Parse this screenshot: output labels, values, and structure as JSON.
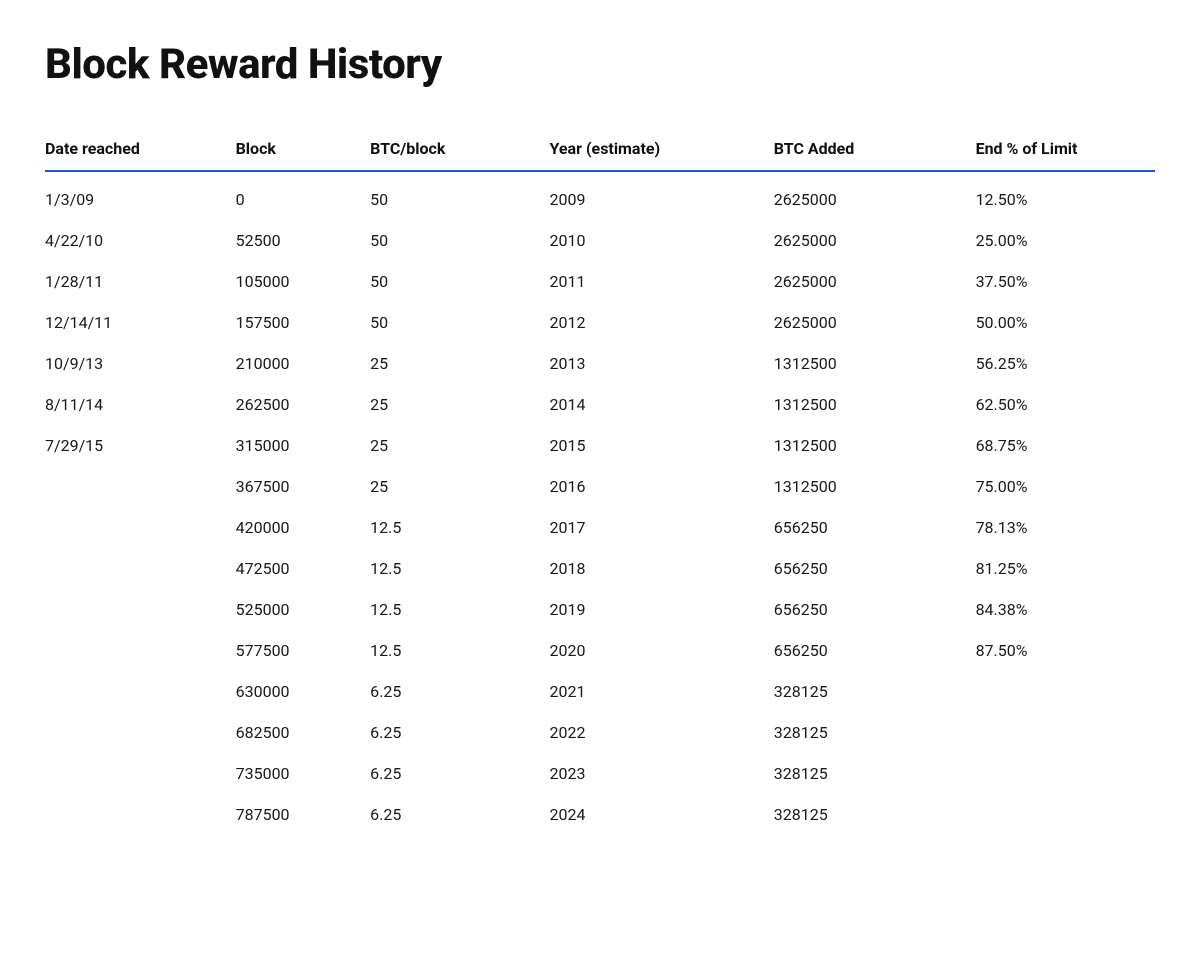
{
  "page": {
    "title": "Block Reward History"
  },
  "table": {
    "columns": [
      {
        "key": "date",
        "label": "Date reached"
      },
      {
        "key": "block",
        "label": "Block"
      },
      {
        "key": "btc_per_block",
        "label": "BTC/block"
      },
      {
        "key": "year_estimate",
        "label": "Year (estimate)"
      },
      {
        "key": "btc_added",
        "label": "BTC Added"
      },
      {
        "key": "end_pct_limit",
        "label": "End % of Limit"
      }
    ],
    "rows": [
      {
        "date": "1/3/09",
        "block": "0",
        "btc_per_block": "50",
        "year_estimate": "2009",
        "btc_added": "2625000",
        "end_pct_limit": "12.50%"
      },
      {
        "date": "4/22/10",
        "block": "52500",
        "btc_per_block": "50",
        "year_estimate": "2010",
        "btc_added": "2625000",
        "end_pct_limit": "25.00%"
      },
      {
        "date": "1/28/11",
        "block": "105000",
        "btc_per_block": "50",
        "year_estimate": "2011",
        "btc_added": "2625000",
        "end_pct_limit": "37.50%"
      },
      {
        "date": "12/14/11",
        "block": "157500",
        "btc_per_block": "50",
        "year_estimate": "2012",
        "btc_added": "2625000",
        "end_pct_limit": "50.00%"
      },
      {
        "date": "10/9/13",
        "block": "210000",
        "btc_per_block": "25",
        "year_estimate": "2013",
        "btc_added": "1312500",
        "end_pct_limit": "56.25%"
      },
      {
        "date": "8/11/14",
        "block": "262500",
        "btc_per_block": "25",
        "year_estimate": "2014",
        "btc_added": "1312500",
        "end_pct_limit": "62.50%"
      },
      {
        "date": "7/29/15",
        "block": "315000",
        "btc_per_block": "25",
        "year_estimate": "2015",
        "btc_added": "1312500",
        "end_pct_limit": "68.75%"
      },
      {
        "date": "",
        "block": "367500",
        "btc_per_block": "25",
        "year_estimate": "2016",
        "btc_added": "1312500",
        "end_pct_limit": "75.00%"
      },
      {
        "date": "",
        "block": "420000",
        "btc_per_block": "12.5",
        "year_estimate": "2017",
        "btc_added": "656250",
        "end_pct_limit": "78.13%"
      },
      {
        "date": "",
        "block": "472500",
        "btc_per_block": "12.5",
        "year_estimate": "2018",
        "btc_added": "656250",
        "end_pct_limit": "81.25%"
      },
      {
        "date": "",
        "block": "525000",
        "btc_per_block": "12.5",
        "year_estimate": "2019",
        "btc_added": "656250",
        "end_pct_limit": "84.38%"
      },
      {
        "date": "",
        "block": "577500",
        "btc_per_block": "12.5",
        "year_estimate": "2020",
        "btc_added": "656250",
        "end_pct_limit": "87.50%"
      },
      {
        "date": "",
        "block": "630000",
        "btc_per_block": "6.25",
        "year_estimate": "2021",
        "btc_added": "328125",
        "end_pct_limit": ""
      },
      {
        "date": "",
        "block": "682500",
        "btc_per_block": "6.25",
        "year_estimate": "2022",
        "btc_added": "328125",
        "end_pct_limit": ""
      },
      {
        "date": "",
        "block": "735000",
        "btc_per_block": "6.25",
        "year_estimate": "2023",
        "btc_added": "328125",
        "end_pct_limit": ""
      },
      {
        "date": "",
        "block": "787500",
        "btc_per_block": "6.25",
        "year_estimate": "2024",
        "btc_added": "328125",
        "end_pct_limit": ""
      }
    ]
  }
}
